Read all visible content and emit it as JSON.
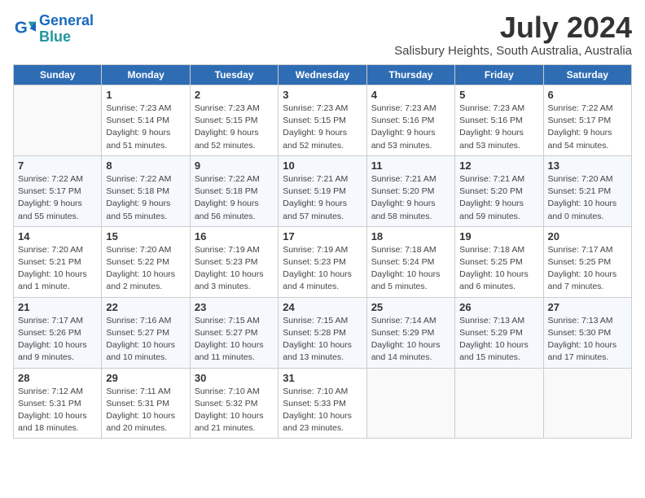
{
  "logo": {
    "text1": "General",
    "text2": "Blue"
  },
  "title": "July 2024",
  "location": "Salisbury Heights, South Australia, Australia",
  "days_of_week": [
    "Sunday",
    "Monday",
    "Tuesday",
    "Wednesday",
    "Thursday",
    "Friday",
    "Saturday"
  ],
  "weeks": [
    [
      {
        "day": "",
        "empty": true
      },
      {
        "day": "1",
        "sunrise": "7:23 AM",
        "sunset": "5:14 PM",
        "daylight": "9 hours and 51 minutes."
      },
      {
        "day": "2",
        "sunrise": "7:23 AM",
        "sunset": "5:15 PM",
        "daylight": "9 hours and 52 minutes."
      },
      {
        "day": "3",
        "sunrise": "7:23 AM",
        "sunset": "5:15 PM",
        "daylight": "9 hours and 52 minutes."
      },
      {
        "day": "4",
        "sunrise": "7:23 AM",
        "sunset": "5:16 PM",
        "daylight": "9 hours and 53 minutes."
      },
      {
        "day": "5",
        "sunrise": "7:23 AM",
        "sunset": "5:16 PM",
        "daylight": "9 hours and 53 minutes."
      },
      {
        "day": "6",
        "sunrise": "7:22 AM",
        "sunset": "5:17 PM",
        "daylight": "9 hours and 54 minutes."
      }
    ],
    [
      {
        "day": "7",
        "sunrise": "7:22 AM",
        "sunset": "5:17 PM",
        "daylight": "9 hours and 55 minutes."
      },
      {
        "day": "8",
        "sunrise": "7:22 AM",
        "sunset": "5:18 PM",
        "daylight": "9 hours and 55 minutes."
      },
      {
        "day": "9",
        "sunrise": "7:22 AM",
        "sunset": "5:18 PM",
        "daylight": "9 hours and 56 minutes."
      },
      {
        "day": "10",
        "sunrise": "7:21 AM",
        "sunset": "5:19 PM",
        "daylight": "9 hours and 57 minutes."
      },
      {
        "day": "11",
        "sunrise": "7:21 AM",
        "sunset": "5:20 PM",
        "daylight": "9 hours and 58 minutes."
      },
      {
        "day": "12",
        "sunrise": "7:21 AM",
        "sunset": "5:20 PM",
        "daylight": "9 hours and 59 minutes."
      },
      {
        "day": "13",
        "sunrise": "7:20 AM",
        "sunset": "5:21 PM",
        "daylight": "10 hours and 0 minutes."
      }
    ],
    [
      {
        "day": "14",
        "sunrise": "7:20 AM",
        "sunset": "5:21 PM",
        "daylight": "10 hours and 1 minute."
      },
      {
        "day": "15",
        "sunrise": "7:20 AM",
        "sunset": "5:22 PM",
        "daylight": "10 hours and 2 minutes."
      },
      {
        "day": "16",
        "sunrise": "7:19 AM",
        "sunset": "5:23 PM",
        "daylight": "10 hours and 3 minutes."
      },
      {
        "day": "17",
        "sunrise": "7:19 AM",
        "sunset": "5:23 PM",
        "daylight": "10 hours and 4 minutes."
      },
      {
        "day": "18",
        "sunrise": "7:18 AM",
        "sunset": "5:24 PM",
        "daylight": "10 hours and 5 minutes."
      },
      {
        "day": "19",
        "sunrise": "7:18 AM",
        "sunset": "5:25 PM",
        "daylight": "10 hours and 6 minutes."
      },
      {
        "day": "20",
        "sunrise": "7:17 AM",
        "sunset": "5:25 PM",
        "daylight": "10 hours and 7 minutes."
      }
    ],
    [
      {
        "day": "21",
        "sunrise": "7:17 AM",
        "sunset": "5:26 PM",
        "daylight": "10 hours and 9 minutes."
      },
      {
        "day": "22",
        "sunrise": "7:16 AM",
        "sunset": "5:27 PM",
        "daylight": "10 hours and 10 minutes."
      },
      {
        "day": "23",
        "sunrise": "7:15 AM",
        "sunset": "5:27 PM",
        "daylight": "10 hours and 11 minutes."
      },
      {
        "day": "24",
        "sunrise": "7:15 AM",
        "sunset": "5:28 PM",
        "daylight": "10 hours and 13 minutes."
      },
      {
        "day": "25",
        "sunrise": "7:14 AM",
        "sunset": "5:29 PM",
        "daylight": "10 hours and 14 minutes."
      },
      {
        "day": "26",
        "sunrise": "7:13 AM",
        "sunset": "5:29 PM",
        "daylight": "10 hours and 15 minutes."
      },
      {
        "day": "27",
        "sunrise": "7:13 AM",
        "sunset": "5:30 PM",
        "daylight": "10 hours and 17 minutes."
      }
    ],
    [
      {
        "day": "28",
        "sunrise": "7:12 AM",
        "sunset": "5:31 PM",
        "daylight": "10 hours and 18 minutes."
      },
      {
        "day": "29",
        "sunrise": "7:11 AM",
        "sunset": "5:31 PM",
        "daylight": "10 hours and 20 minutes."
      },
      {
        "day": "30",
        "sunrise": "7:10 AM",
        "sunset": "5:32 PM",
        "daylight": "10 hours and 21 minutes."
      },
      {
        "day": "31",
        "sunrise": "7:10 AM",
        "sunset": "5:33 PM",
        "daylight": "10 hours and 23 minutes."
      },
      {
        "day": "",
        "empty": true
      },
      {
        "day": "",
        "empty": true
      },
      {
        "day": "",
        "empty": true
      }
    ]
  ]
}
